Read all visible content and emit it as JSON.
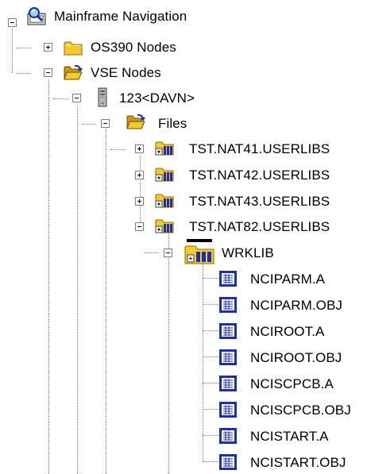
{
  "tree": {
    "root": {
      "label": "Mainframe Navigation",
      "icon": "mainframe-navigation-icon"
    },
    "os390": {
      "label": "OS390 Nodes",
      "expander": "+",
      "icon": "closed-folder-icon"
    },
    "vse": {
      "label": "VSE Nodes",
      "expander": "-",
      "icon": "open-folder-icon"
    },
    "server": {
      "label": "123<DAVN>",
      "expander": "-",
      "icon": "server-icon"
    },
    "files": {
      "label": "Files",
      "expander": "-",
      "icon": "open-folder-icon"
    },
    "libs": [
      {
        "label": "TST.NAT41.USERLIBS",
        "expander": "+"
      },
      {
        "label": "TST.NAT42.USERLIBS",
        "expander": "+"
      },
      {
        "label": "TST.NAT43.USERLIBS",
        "expander": "+"
      },
      {
        "label": "TST.NAT82.USERLIBS",
        "expander": "-"
      }
    ],
    "wrklib": {
      "label": "WRKLIB",
      "expander": "-",
      "icon": "library-icon"
    },
    "objects": [
      "NCIPARM.A",
      "NCIPARM.OBJ",
      "NCIROOT.A",
      "NCIROOT.OBJ",
      "NCISCPCB.A",
      "NCISCPCB.OBJ",
      "NCISTART.A",
      "NCISTART.OBJ"
    ]
  },
  "colors": {
    "folder": "#f2cc2f",
    "folder_dark": "#b8860b",
    "member_blue": "#1d2fa8",
    "tree_lines": "#808080"
  }
}
